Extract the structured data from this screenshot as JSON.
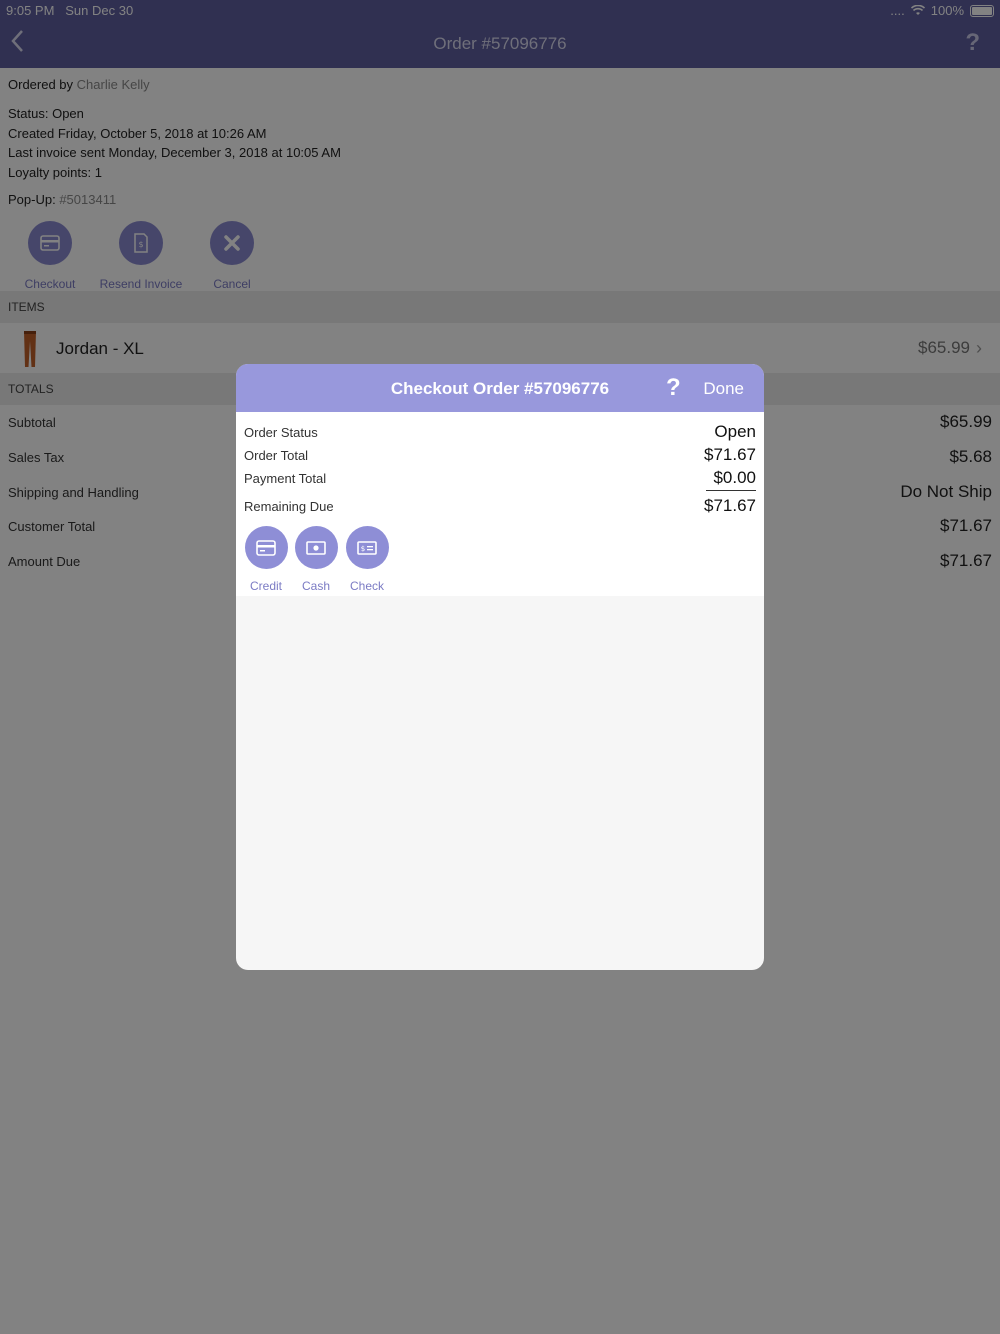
{
  "status_bar": {
    "time": "9:05 PM",
    "date": "Sun Dec 30",
    "signal": "....",
    "battery": "100%"
  },
  "nav": {
    "back_icon": "chevron-left-icon",
    "title": "Order #57096776",
    "help": "?"
  },
  "order": {
    "ordered_by_label": "Ordered by ",
    "ordered_by_name": "Charlie Kelly",
    "status": "Status: Open",
    "created": "Created Friday, October 5, 2018 at 10:26 AM",
    "last_invoice": "Last invoice sent Monday, December 3, 2018 at 10:05 AM",
    "loyalty": "Loyalty points: 1",
    "popup_label": "Pop-Up: ",
    "popup_value": "#5013411"
  },
  "actions": [
    {
      "label": "Checkout",
      "icon": "credit-card-icon"
    },
    {
      "label": "Resend Invoice",
      "icon": "invoice-icon"
    },
    {
      "label": "Cancel",
      "icon": "close-icon"
    }
  ],
  "items_header": "ITEMS",
  "items": [
    {
      "name": "Jordan - XL",
      "price": "$65.99",
      "icon": "pants-icon"
    }
  ],
  "totals_header": "TOTALS",
  "totals": [
    {
      "label": "Subtotal",
      "value": "$65.99"
    },
    {
      "label": "Sales Tax",
      "value": "$5.68"
    },
    {
      "label": "Shipping and Handling",
      "value": "Do Not Ship"
    },
    {
      "label": "Customer Total",
      "value": "$71.67"
    },
    {
      "label": "Amount Due",
      "value": "$71.67"
    }
  ],
  "modal": {
    "title": "Checkout Order #57096776",
    "help": "?",
    "done": "Done",
    "rows": [
      {
        "label": "Order Status",
        "value": "Open"
      },
      {
        "label": "Order Total",
        "value": "$71.67"
      },
      {
        "label": "Payment Total",
        "value": "$0.00"
      },
      {
        "label": "Remaining Due",
        "value": "$71.67"
      }
    ],
    "payment_methods": [
      {
        "label": "Credit",
        "icon": "credit-card-icon"
      },
      {
        "label": "Cash",
        "icon": "cash-icon"
      },
      {
        "label": "Check",
        "icon": "check-icon"
      }
    ]
  },
  "colors": {
    "accent": "#5f5f9f",
    "modal_header": "#9898dc",
    "button": "#8a8ad0"
  }
}
